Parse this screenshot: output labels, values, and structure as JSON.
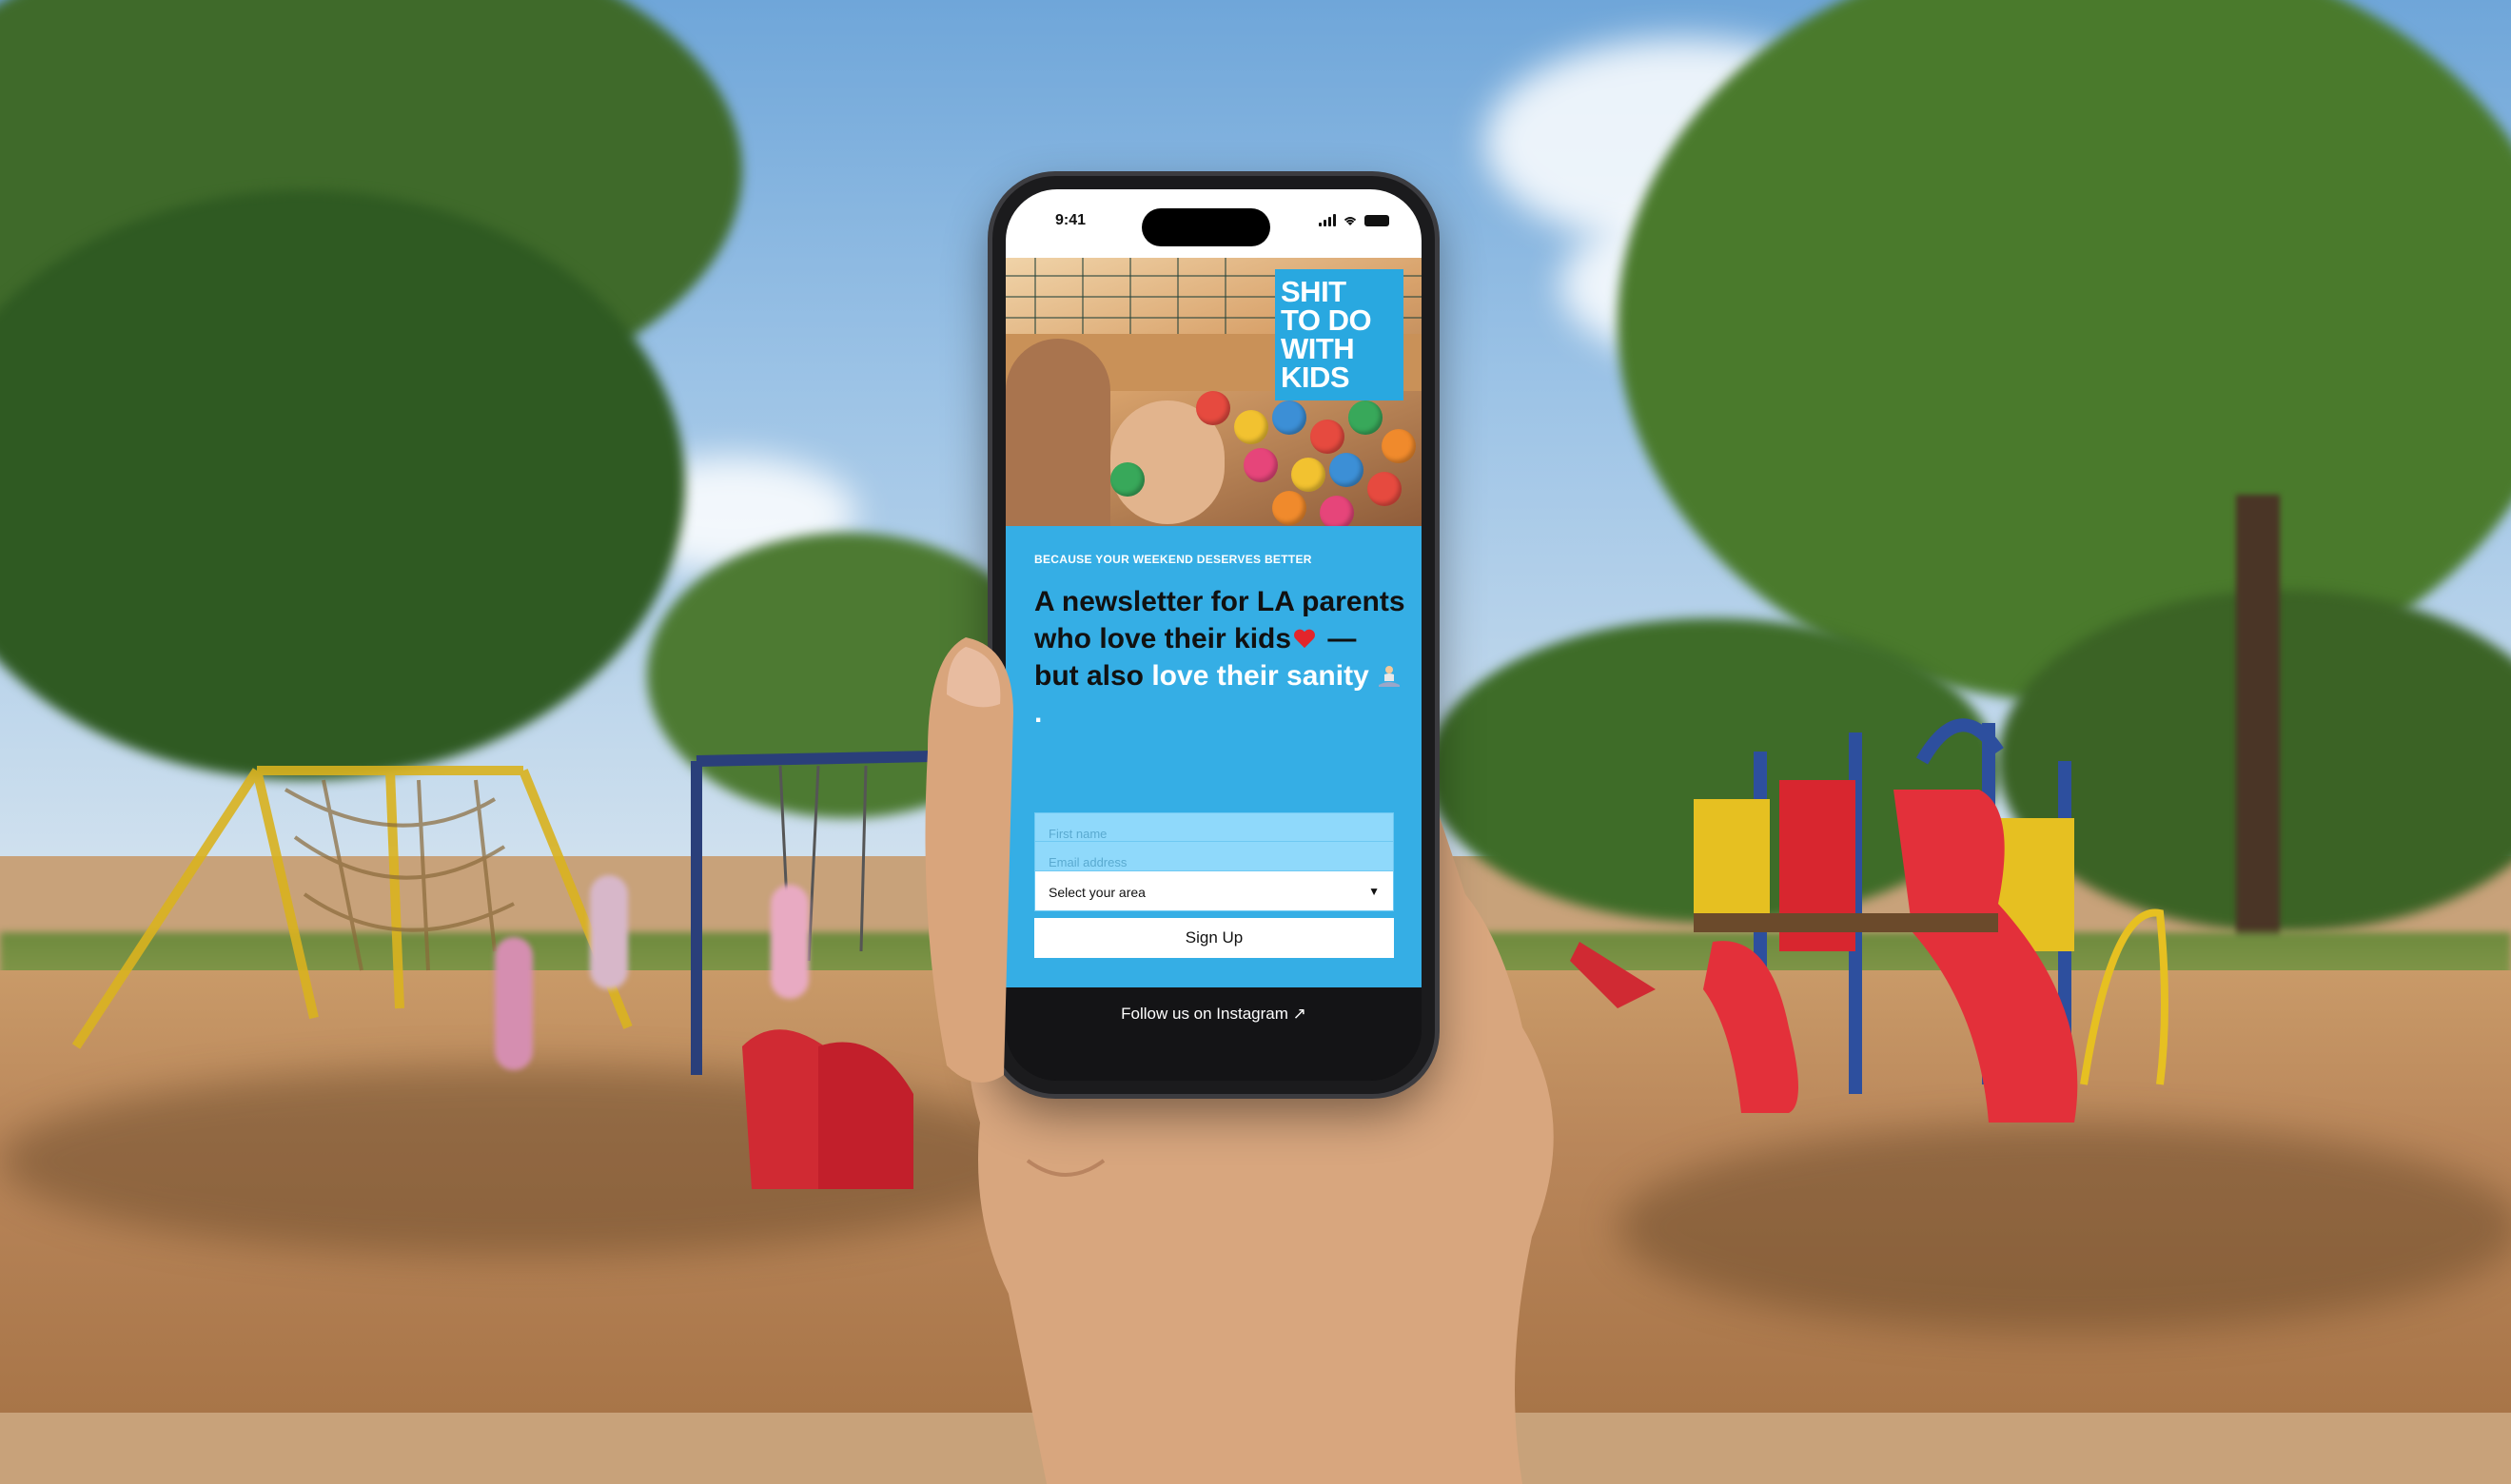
{
  "status_bar": {
    "time": "9:41"
  },
  "brand": {
    "logo_lines": [
      "SHIT",
      "TO DO",
      "WITH",
      "KIDS"
    ]
  },
  "content": {
    "eyebrow": "BECAUSE YOUR WEEKEND DESERVES BETTER",
    "headline_part1": "A newsletter for LA parents who love their kids",
    "headline_part2": " — but also ",
    "headline_part3": "love their sanity",
    "headline_end": "."
  },
  "form": {
    "first_name_placeholder": "First name",
    "email_placeholder": "Email address",
    "area_select_value": "Select your area",
    "submit_label": "Sign Up"
  },
  "footer": {
    "instagram_link": "Follow us on Instagram ↗"
  },
  "colors": {
    "panel_blue": "#35aee5",
    "logo_blue": "#29a8e0",
    "input_blue": "#8fd9fb",
    "heart_red": "#e3252b"
  },
  "icons": [
    "signal-icon",
    "wifi-icon",
    "battery-icon",
    "red-heart-icon",
    "meditating-person-icon",
    "select-caret-icon",
    "external-link-arrow-icon"
  ]
}
